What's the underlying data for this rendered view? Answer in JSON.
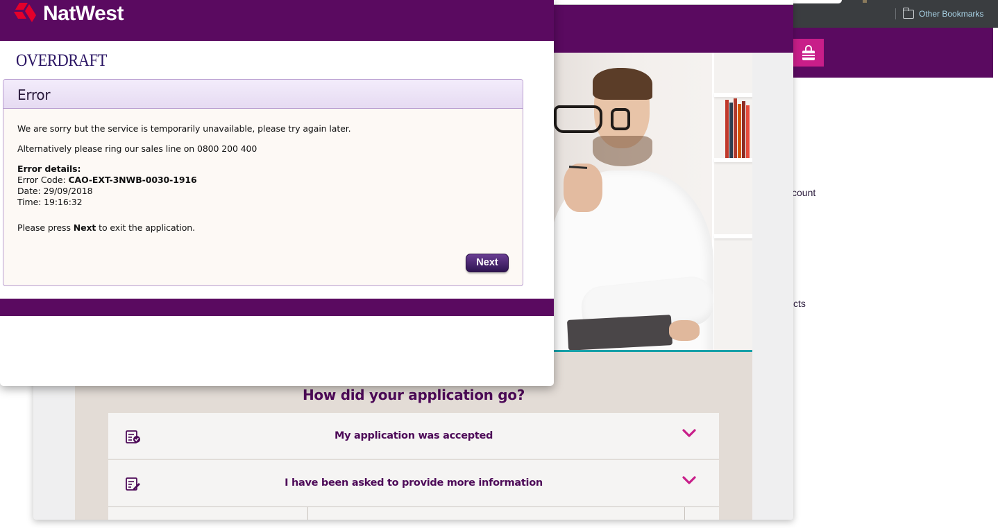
{
  "browser": {
    "bookmarks_label": "Other Bookmarks",
    "bg_partial_text_1": "count",
    "bg_partial_text_2": "cts"
  },
  "popup": {
    "brand": "NatWest",
    "page_title": "OVERDRAFT",
    "error": {
      "title": "Error",
      "message": "We are sorry but the service is temporarily unavailable, please try again later.",
      "alternative": "Alternatively please ring our sales line on 0800 200 400",
      "details_label": "Error details:",
      "code_label": "Error Code: ",
      "code_value": "CAO-EXT-3NWB-0030-1916",
      "date_line": "Date: 29/09/2018",
      "time_line": "Time: 19:16:32",
      "exit_prefix": "Please press ",
      "exit_keyword": "Next",
      "exit_suffix": " to exit the application.",
      "next_button": "Next"
    }
  },
  "page": {
    "section_heading": "How did your application go?",
    "accordion": [
      {
        "label": "My application was accepted",
        "icon": "document-check-icon"
      },
      {
        "label": "I have been asked to provide more information",
        "icon": "document-edit-icon"
      }
    ]
  },
  "colors": {
    "brand_purple": "#5a0a60",
    "accent_magenta": "#c81e89",
    "heading_purple": "#4d0a58"
  }
}
